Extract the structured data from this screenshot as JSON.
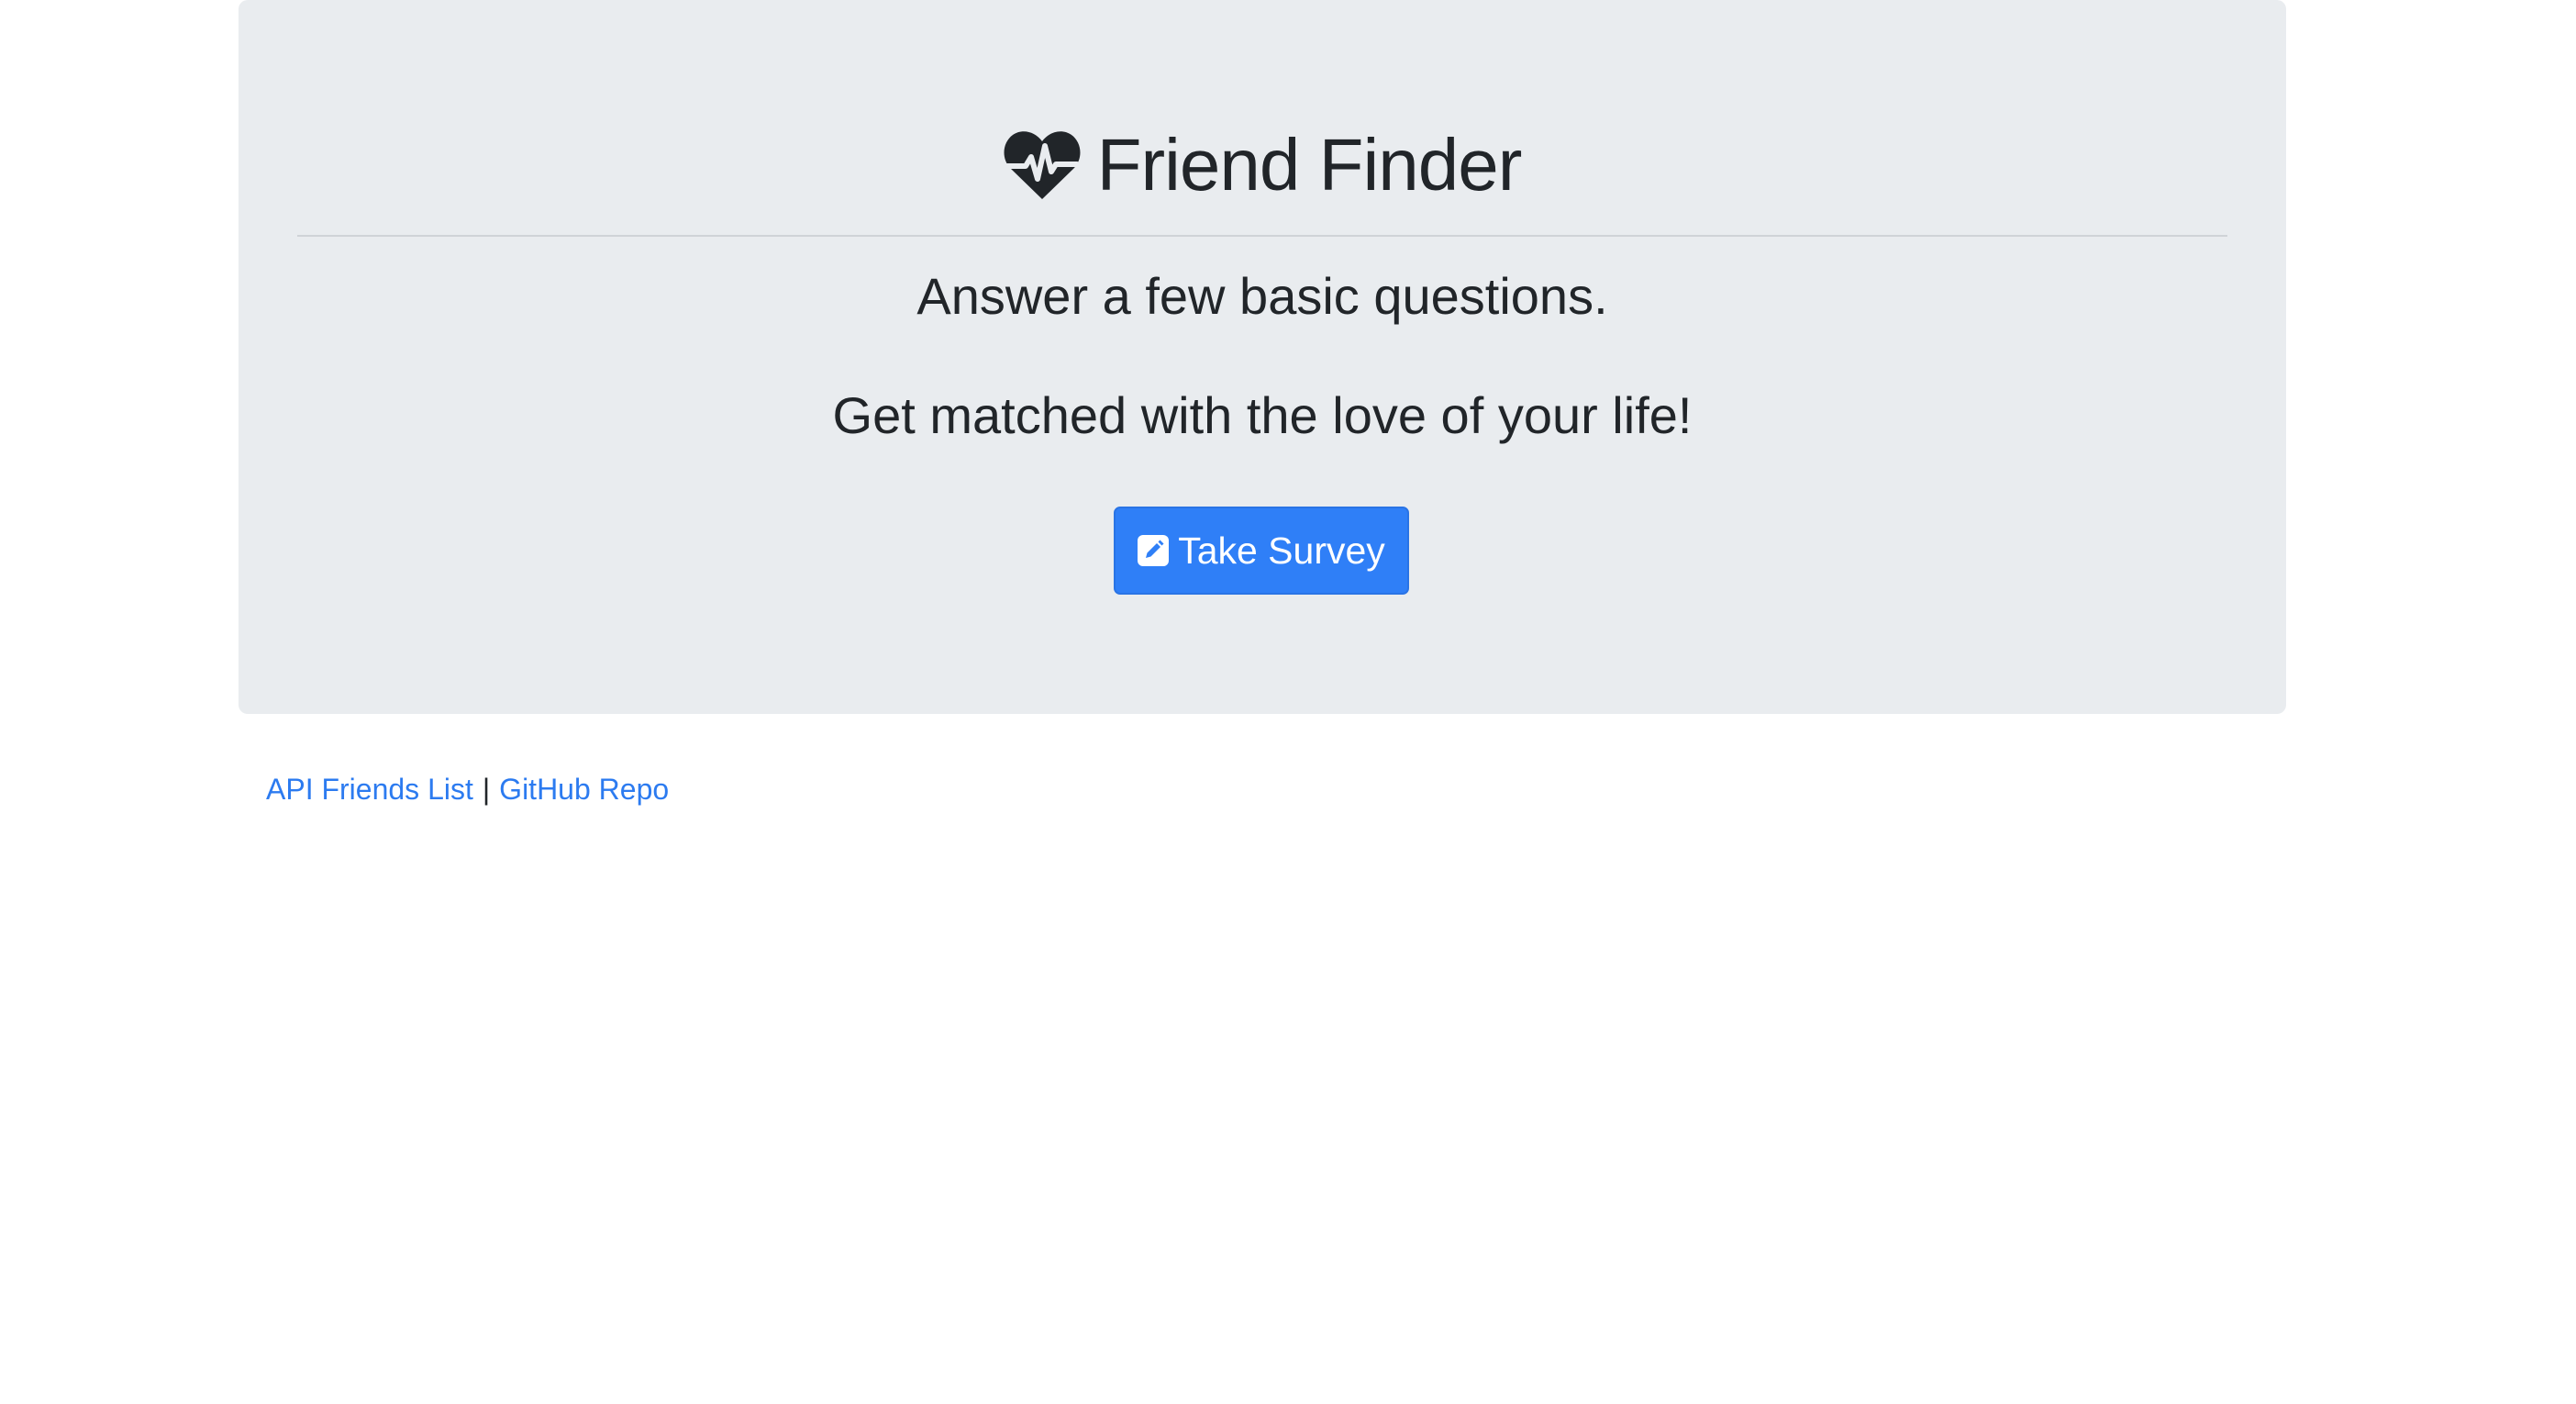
{
  "header": {
    "icon": "heartbeat-icon",
    "title": "Friend Finder"
  },
  "intro": {
    "line1": "Answer a few basic questions.",
    "line2": "Get matched with the love of your life!"
  },
  "survey_button": {
    "icon": "edit-icon",
    "label": "Take Survey"
  },
  "footer": {
    "api_link": "API Friends List",
    "separator": "|",
    "repo_link": "GitHub Repo"
  },
  "colors": {
    "jumbotron_bg": "#e9ecef",
    "primary": "#2f7ff7",
    "link": "#2c7bf0",
    "text": "#212529"
  }
}
